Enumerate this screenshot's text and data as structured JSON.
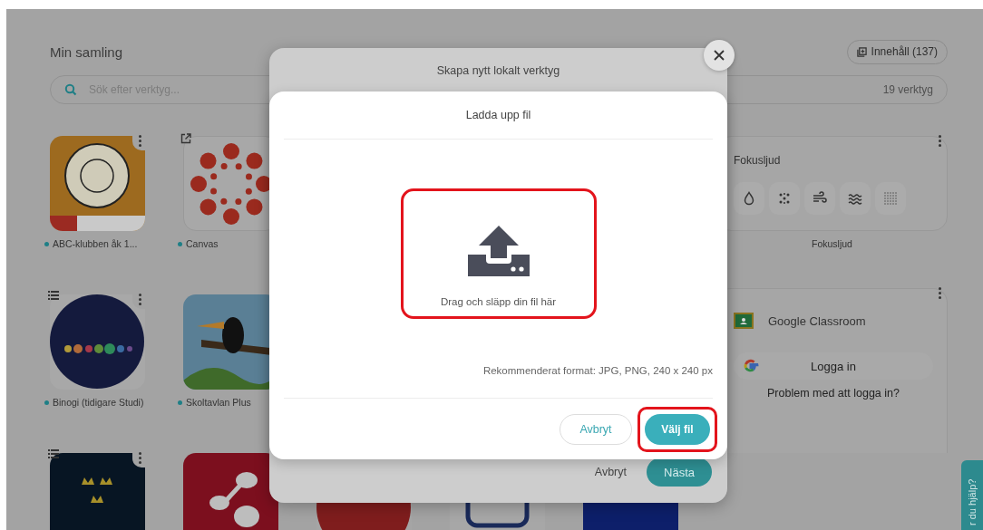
{
  "page": {
    "title": "Min samling",
    "content_button": "Innehåll (137)",
    "search": {
      "placeholder": "Sök efter verktyg..."
    },
    "tool_count": "19 verktyg"
  },
  "tile_rows": [
    {
      "tiles": [
        {
          "kind": "abc",
          "label": "ABC-klubben åk 1...",
          "menu": true,
          "link": false,
          "list": false
        },
        {
          "kind": "canvas",
          "label": "Canvas",
          "menu": false,
          "link": true,
          "list": false
        }
      ]
    },
    {
      "tiles": [
        {
          "kind": "binogi",
          "label": "Binogi (tidigare Studi)",
          "menu": true,
          "link": false,
          "list": true
        },
        {
          "kind": "toucan",
          "label": "Skoltavlan Plus",
          "menu": false,
          "link": false,
          "list": false
        }
      ]
    },
    {
      "tiles": [
        {
          "kind": "crown",
          "menu": true,
          "link": false,
          "list": true
        },
        {
          "kind": "red",
          "menu": false,
          "link": false,
          "list": false
        },
        {
          "kind": "person"
        },
        {
          "kind": "kubo"
        },
        {
          "kind": "navy"
        }
      ]
    }
  ],
  "fokusljud": {
    "title": "Fokusljud",
    "sounds": [
      {
        "kind": "drop"
      },
      {
        "kind": "dots"
      },
      {
        "kind": "wind"
      },
      {
        "kind": "waves"
      },
      {
        "kind": "grid"
      }
    ],
    "label": "Fokusljud"
  },
  "classroom": {
    "title": "Google Classroom",
    "login_button": "Logga in",
    "problem_link": "Problem med att logga in?"
  },
  "help_tab": "r du hjälp?",
  "back_modal": {
    "title": "Skapa nytt lokalt verktyg",
    "cancel": "Avbryt",
    "next": "Nästa"
  },
  "upload_modal": {
    "title": "Ladda upp fil",
    "drop_text": "Drag och släpp din fil här",
    "drop_highlighted": true,
    "format_hint": "Rekommenderat format: JPG, PNG, 240 x 240 px",
    "cancel": "Avbryt",
    "choose": "Välj fil",
    "choose_highlighted": true
  }
}
